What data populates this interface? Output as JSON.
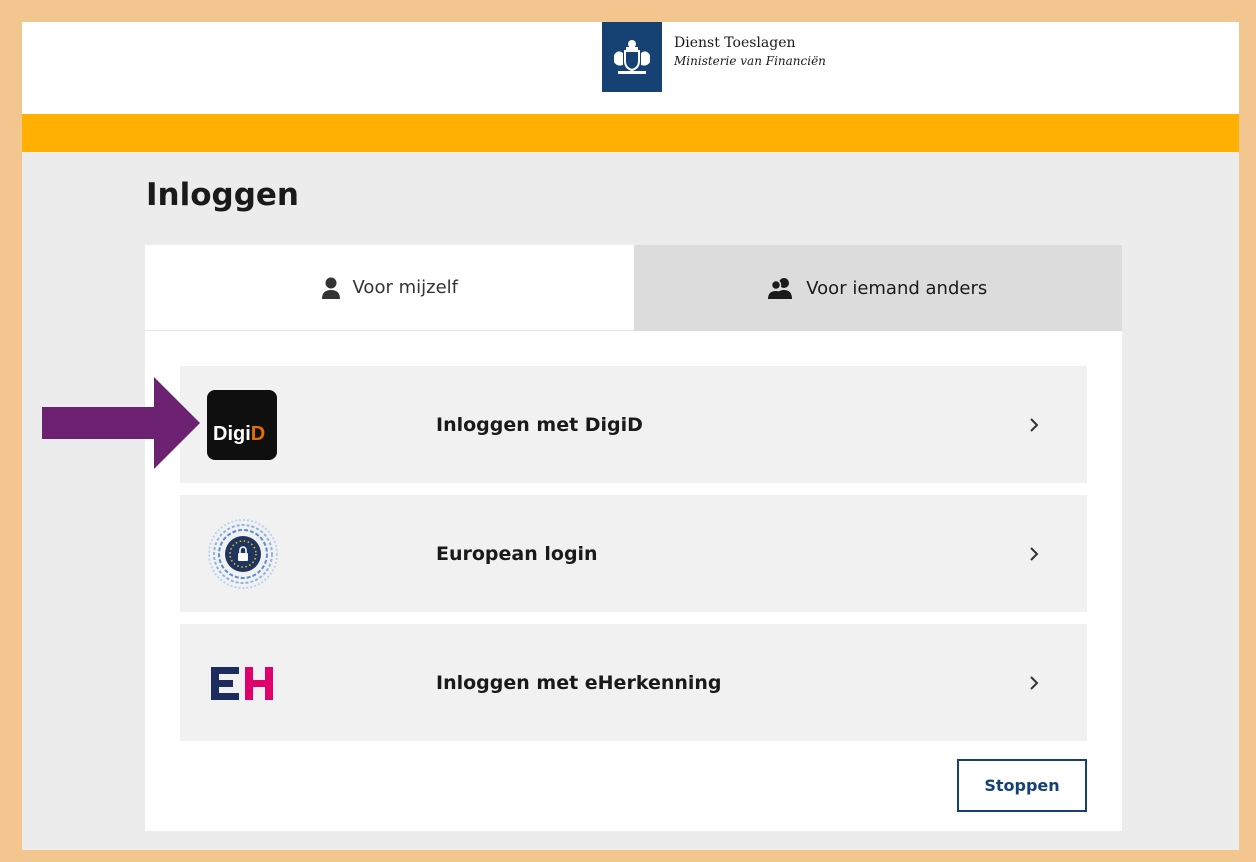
{
  "header": {
    "org_name": "Dienst Toeslagen",
    "ministry": "Ministerie van Financiën",
    "logo_icon": "coat-of-arms-icon",
    "brand_color": "#154273",
    "accent_color": "#ffb000"
  },
  "page": {
    "title": "Inloggen"
  },
  "tabs": [
    {
      "label": "Voor mijzelf",
      "icon": "person-icon",
      "active": true
    },
    {
      "label": "Voor iemand anders",
      "icon": "people-icon",
      "active": false
    }
  ],
  "login_options": [
    {
      "label": "Inloggen met DigiD",
      "logo": "digid-logo",
      "logo_text_white": "Digi",
      "logo_text_orange": "D"
    },
    {
      "label": "European login",
      "logo": "eu-login-icon"
    },
    {
      "label": "Inloggen met eHerkenning",
      "logo": "eherkenning-logo"
    }
  ],
  "actions": {
    "stop_label": "Stoppen"
  },
  "annotation": {
    "arrow_color": "#6c2270",
    "arrow_icon": "arrow-right-icon"
  }
}
